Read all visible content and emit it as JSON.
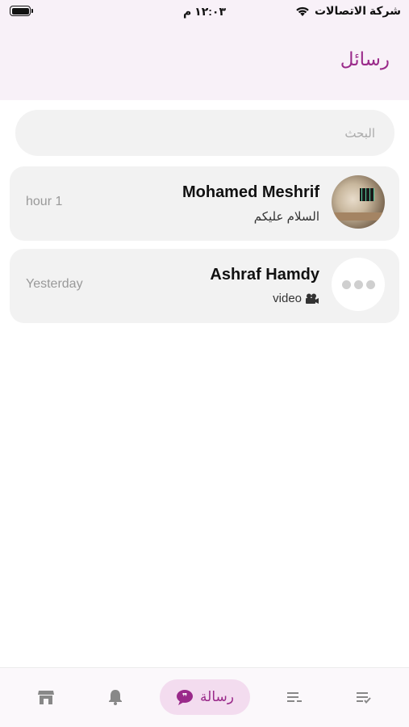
{
  "status_bar": {
    "carrier": "شركة الاتصالات",
    "time": "١٢:٠٣ م"
  },
  "header": {
    "title": "رسائل"
  },
  "search": {
    "placeholder": "البحث"
  },
  "conversations": [
    {
      "name": "Mohamed Meshrif",
      "preview": "السلام عليكم",
      "time": "hour 1",
      "avatar": "photo"
    },
    {
      "name": "Ashraf Hamdy",
      "preview": "video",
      "preview_icon": "video-camera-icon",
      "time": "Yesterday",
      "avatar": "default-avatar-icon"
    }
  ],
  "tabbar": {
    "items": [
      {
        "icon": "store-icon"
      },
      {
        "icon": "bell-icon"
      },
      {
        "icon": "chat-bubble-icon",
        "label": "رسالة",
        "active": true
      },
      {
        "icon": "list-icon"
      },
      {
        "icon": "task-list-icon"
      }
    ]
  },
  "colors": {
    "accent": "#9a2a8a",
    "header_bg": "#f8f1f8",
    "card_bg": "#f2f2f2",
    "active_tab_bg": "#f3dcef"
  }
}
